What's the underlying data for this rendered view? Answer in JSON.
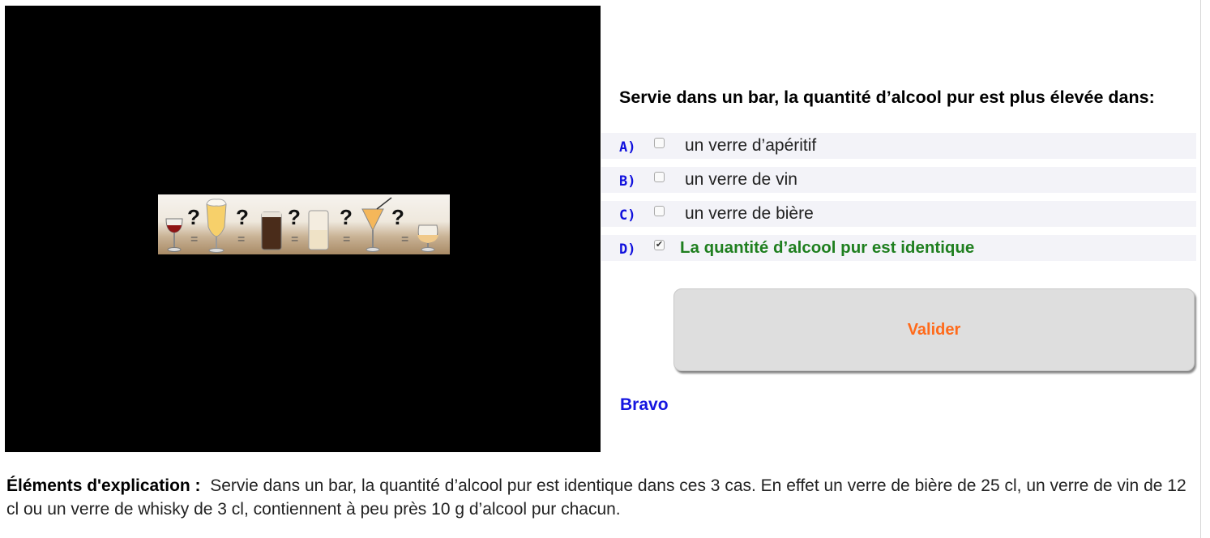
{
  "media": {
    "image_icon": "drinks-equivalence-illustration"
  },
  "question": {
    "text": "Servie dans un bar, la quantité d’alcool pur est plus élevée dans:"
  },
  "options": [
    {
      "letter": "A)",
      "text": "un verre d’apéritif",
      "checked": false
    },
    {
      "letter": "B)",
      "text": "un verre de vin",
      "checked": false
    },
    {
      "letter": "C)",
      "text": "un verre de bière",
      "checked": false
    },
    {
      "letter": "D)",
      "text": "La quantité d’alcool pur est identique",
      "checked": true,
      "check_mark": "✔"
    }
  ],
  "validate_label": "Valider",
  "feedback": "Bravo",
  "explanation": {
    "label": "Éléments d'explication :",
    "text": "Servie dans un bar, la quantité d’alcool pur est identique dans ces 3 cas. En effet un verre de bière de 25 cl, un verre de vin de 12 cl ou un verre de whisky de 3 cl, contiennent à peu près 10 g d’alcool pur chacun."
  },
  "colors": {
    "letter": "#1010dd",
    "correct_answer": "#1f7f1f",
    "validate_text": "#ff6a1a",
    "feedback": "#1515e0"
  }
}
